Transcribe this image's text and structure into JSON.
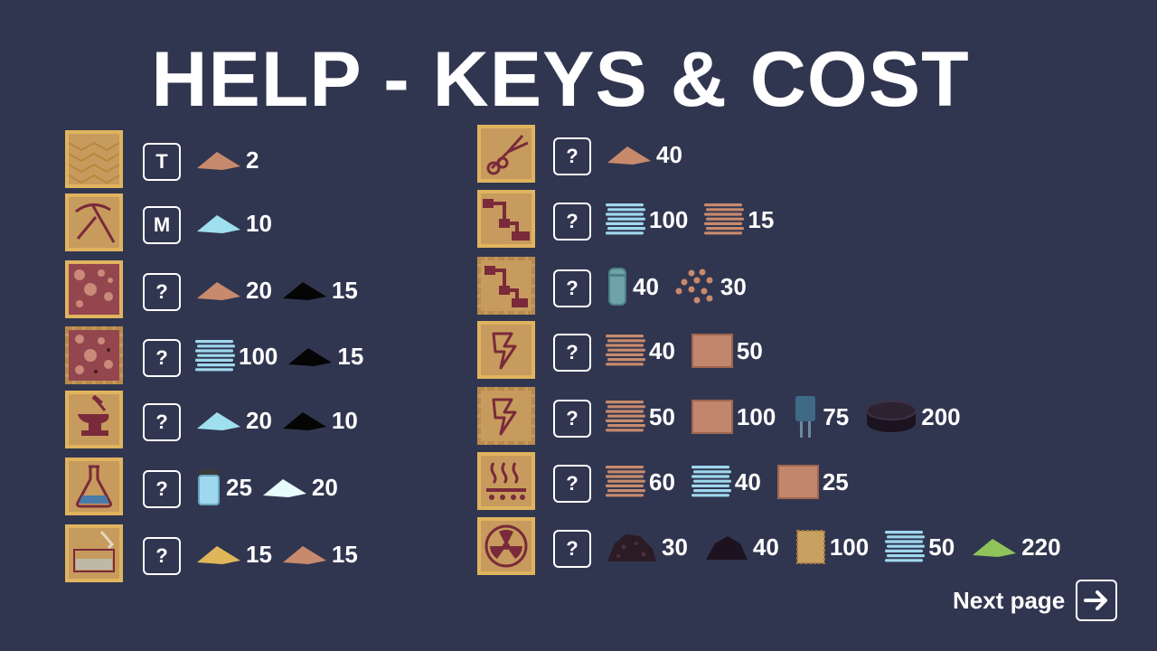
{
  "title": "HELP - KEYS & COST",
  "next_page_label": "Next page",
  "colors": {
    "background": "#313650",
    "tile": "#c79b5d",
    "tile_border": "#e0b45e",
    "text": "#ffffff"
  },
  "left_rows": [
    {
      "tile": "wood-floor-tile",
      "key": "T",
      "costs": [
        {
          "icon": "clay-pile",
          "amount": "2"
        }
      ]
    },
    {
      "tile": "pickaxe-tile",
      "key": "M",
      "costs": [
        {
          "icon": "ice-pile",
          "amount": "10"
        }
      ]
    },
    {
      "tile": "rock-wall-tile",
      "key": "?",
      "costs": [
        {
          "icon": "clay-pile",
          "amount": "20"
        },
        {
          "icon": "coal-pile",
          "amount": "15"
        }
      ]
    },
    {
      "tile": "reinforced-rock-wall-tile",
      "key": "?",
      "costs": [
        {
          "icon": "blue-plates",
          "amount": "100"
        },
        {
          "icon": "coal-pile",
          "amount": "15"
        }
      ]
    },
    {
      "tile": "anvil-tile",
      "key": "?",
      "costs": [
        {
          "icon": "ice-pile",
          "amount": "20"
        },
        {
          "icon": "coal-pile",
          "amount": "10"
        }
      ]
    },
    {
      "tile": "flask-tile",
      "key": "?",
      "costs": [
        {
          "icon": "glass-jar",
          "amount": "25"
        },
        {
          "icon": "snow-pile",
          "amount": "20"
        }
      ]
    },
    {
      "tile": "glass-tank-tile",
      "key": "?",
      "costs": [
        {
          "icon": "sand-pile",
          "amount": "15"
        },
        {
          "icon": "clay-pile",
          "amount": "15"
        }
      ]
    }
  ],
  "right_rows": [
    {
      "tile": "cutter-tile",
      "key": "?",
      "costs": [
        {
          "icon": "clay-pile",
          "amount": "40"
        }
      ]
    },
    {
      "tile": "pipe-tile",
      "key": "?",
      "costs": [
        {
          "icon": "blue-plates",
          "amount": "100"
        },
        {
          "icon": "copper-plates",
          "amount": "15"
        }
      ]
    },
    {
      "tile": "reinforced-pipe-tile",
      "key": "?",
      "costs": [
        {
          "icon": "battery-cell",
          "amount": "40"
        },
        {
          "icon": "copper-pellets",
          "amount": "30"
        }
      ]
    },
    {
      "tile": "power-tile",
      "key": "?",
      "costs": [
        {
          "icon": "copper-plates",
          "amount": "40"
        },
        {
          "icon": "copper-block",
          "amount": "50"
        }
      ]
    },
    {
      "tile": "reinforced-power-tile",
      "key": "?",
      "costs": [
        {
          "icon": "copper-plates",
          "amount": "50"
        },
        {
          "icon": "copper-block",
          "amount": "100"
        },
        {
          "icon": "capacitor",
          "amount": "75"
        },
        {
          "icon": "coil-disc",
          "amount": "200"
        }
      ]
    },
    {
      "tile": "heater-tile",
      "key": "?",
      "costs": [
        {
          "icon": "copper-plates",
          "amount": "60"
        },
        {
          "icon": "blue-plates",
          "amount": "40"
        },
        {
          "icon": "copper-block",
          "amount": "25"
        }
      ]
    },
    {
      "tile": "radiation-tile",
      "key": "?",
      "costs": [
        {
          "icon": "ore-rock",
          "amount": "30"
        },
        {
          "icon": "dark-rock",
          "amount": "40"
        },
        {
          "icon": "cardboard-panel",
          "amount": "100"
        },
        {
          "icon": "blue-plates",
          "amount": "50"
        },
        {
          "icon": "green-pile",
          "amount": "220"
        }
      ]
    }
  ]
}
